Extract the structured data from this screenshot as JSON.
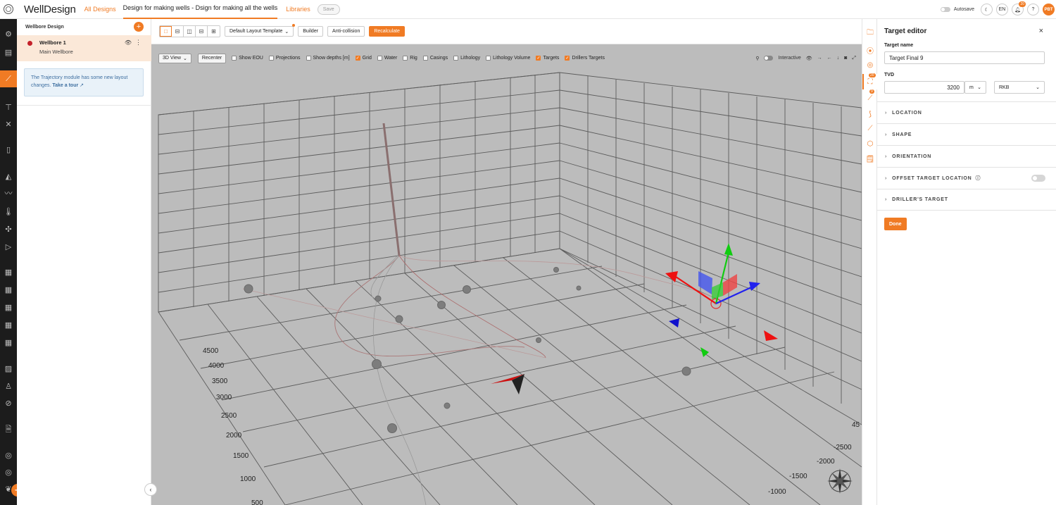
{
  "app": {
    "brand": "WellDesign",
    "nav_all_designs": "All Designs",
    "nav_current_design": "Design for making wells - Dsign for making all the wells",
    "nav_libraries": "Libraries",
    "save_label": "Save",
    "autosave_label": "Autosave",
    "language": "EN",
    "notification_count": "20",
    "help_label": "?",
    "user_initials": "PBT"
  },
  "wellbore_panel": {
    "title": "Wellbore Design",
    "add_label": "+",
    "items": [
      {
        "name": "Wellbore 1",
        "subtitle": "Main Wellbore"
      }
    ],
    "info_text": "The Trajectory module has some new layout changes.",
    "info_link": "Take a tour"
  },
  "toolbar": {
    "template_label": "Default Layout Template",
    "builder_label": "Builder",
    "anticollision_label": "Anti-collision",
    "recalculate_label": "Recalculate"
  },
  "viewport": {
    "view_select": "3D View",
    "recenter_label": "Recenter",
    "checkboxes": [
      {
        "label": "Show EOU",
        "checked": false
      },
      {
        "label": "Projections",
        "checked": false
      },
      {
        "label": "Show depths [m]",
        "checked": false
      },
      {
        "label": "Grid",
        "checked": true
      },
      {
        "label": "Water",
        "checked": false
      },
      {
        "label": "Rig",
        "checked": false
      },
      {
        "label": "Casings",
        "checked": false
      },
      {
        "label": "Lithology",
        "checked": false
      },
      {
        "label": "Lithology Volume",
        "checked": false
      },
      {
        "label": "Targets",
        "checked": true
      },
      {
        "label": "Drillers Targets",
        "checked": true
      }
    ],
    "interactive_label": "Interactive",
    "left_axis_ticks": [
      "4500",
      "4000",
      "3500",
      "3000",
      "2500",
      "2000",
      "1500",
      "1000",
      "500"
    ],
    "right_axis_ticks": [
      "-2500",
      "-2000",
      "-1500",
      "-1000"
    ],
    "right_axis_partial": "45"
  },
  "target_editor": {
    "title": "Target editor",
    "close_label": "×",
    "name_label": "Target name",
    "name_value": "Target Final 9",
    "tvd_label": "TVD",
    "tvd_value": "3200",
    "unit": "m",
    "reference": "RKB",
    "sections": [
      "LOCATION",
      "SHAPE",
      "ORIENTATION",
      "OFFSET TARGET LOCATION",
      "DRILLER'S TARGET"
    ],
    "done_label": "Done"
  },
  "colors": {
    "accent": "#f07b24",
    "rail": "#1c1c1c",
    "viewport_bg": "#bcbcbc",
    "wellbore_dot": "#c4212b"
  }
}
